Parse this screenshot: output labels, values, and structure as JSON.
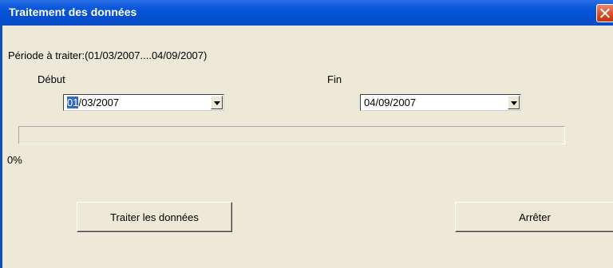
{
  "window": {
    "title": "Traitement des données",
    "close_icon": "close-icon"
  },
  "period_label": "Période à traiter:(01/03/2007....04/09/2007)",
  "start": {
    "label": "Début",
    "value_selected": "01",
    "value_rest": "/03/2007"
  },
  "end": {
    "label": "Fin",
    "value": "04/09/2007"
  },
  "progress": {
    "fraction": 0.0,
    "percent_text": "0%"
  },
  "buttons": {
    "process": "Traiter les données",
    "stop": "Arrêter"
  },
  "colors": {
    "titlebar": "#0a58dc",
    "face": "#ece9d8",
    "close": "#d2421e",
    "selection": "#316ac5"
  }
}
